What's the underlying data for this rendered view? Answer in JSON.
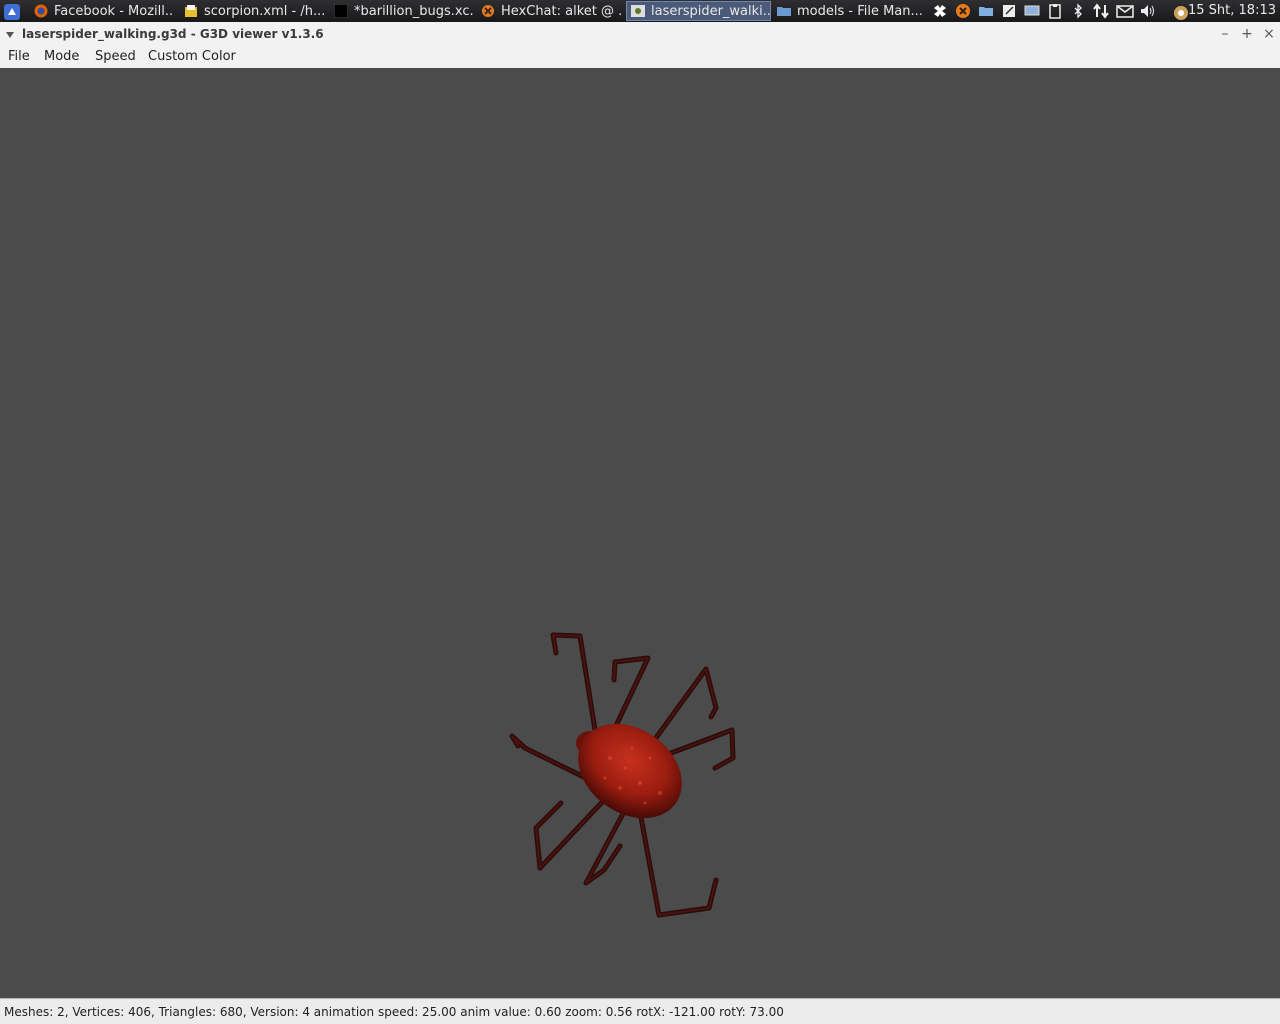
{
  "taskbar": {
    "tasks": [
      {
        "label": "Facebook - Mozill...",
        "icon": "firefox-icon"
      },
      {
        "label": "scorpion.xml - /h...",
        "icon": "text-editor-icon"
      },
      {
        "label": "*barillion_bugs.xc...",
        "icon": "terminal-icon"
      },
      {
        "label": "HexChat: alket @ ...",
        "icon": "hexchat-icon"
      },
      {
        "label": "laserspider_walki...",
        "icon": "g3d-viewer-icon",
        "active": true
      },
      {
        "label": "models - File Man...",
        "icon": "folder-icon"
      }
    ],
    "tray_icons": [
      "dropbox-icon",
      "hexchat-tray-icon",
      "folder-tray-icon",
      "notes-icon",
      "display-icon",
      "clipboard-icon",
      "bluetooth-icon",
      "network-icon",
      "mail-icon",
      "volume-icon",
      "update-icon"
    ],
    "clock": "15 Sht, 18:13"
  },
  "window": {
    "title": "laserspider_walking.g3d - G3D viewer v1.3.6",
    "minimize": "–",
    "maximize": "+",
    "close": "×"
  },
  "menu": [
    "File",
    "Mode",
    "Speed",
    "Custom Color"
  ],
  "viewport": {
    "background": "#4b4b4b",
    "model": "laserspider"
  },
  "status": "Meshes: 2, Vertices: 406, Triangles: 680, Version: 4 animation speed: 25.00 anim value: 0.60 zoom: 0.56 rotX: -121.00 rotY: 73.00"
}
